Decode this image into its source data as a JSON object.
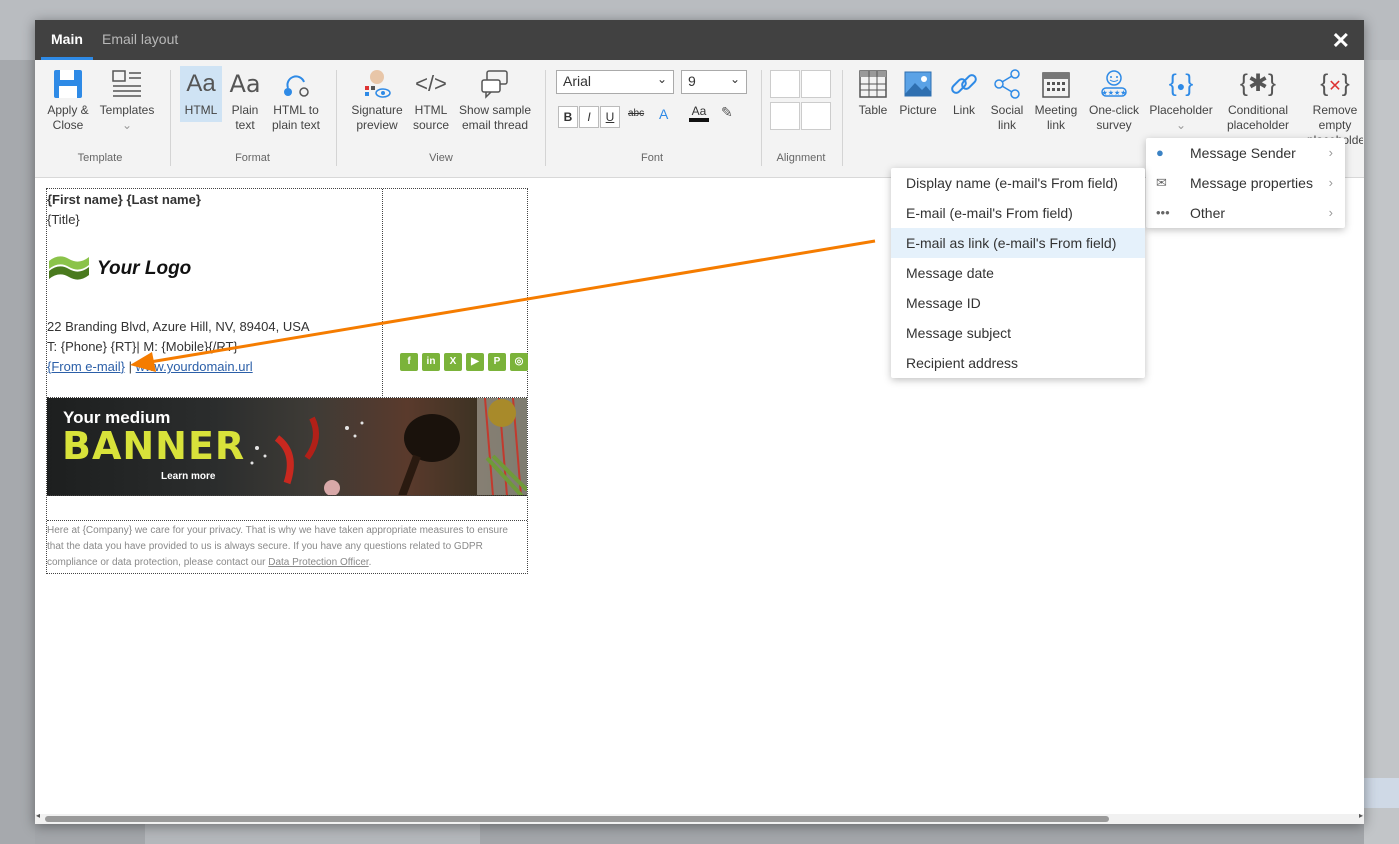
{
  "tabs": {
    "main": "Main",
    "email_layout": "Email layout"
  },
  "close_symbol": "✕",
  "ribbon": {
    "template": {
      "apply_close": "Apply & Close",
      "templates": "Templates",
      "label": "Template"
    },
    "format": {
      "html": "HTML",
      "plain_text": "Plain text",
      "html_to_plain": "HTML to plain text",
      "label": "Format"
    },
    "view": {
      "signature_preview": "Signature preview",
      "html_source": "HTML source",
      "show_sample": "Show sample email thread",
      "label": "View"
    },
    "font": {
      "family": "Arial",
      "size": "9",
      "bold": "B",
      "italic": "I",
      "underline": "U",
      "strike": "abc",
      "label": "Font"
    },
    "alignment": {
      "label": "Alignment"
    },
    "insert": {
      "table": "Table",
      "picture": "Picture",
      "link": "Link",
      "social_link": "Social link",
      "meeting_link": "Meeting link",
      "one_click_survey": "One-click survey",
      "placeholder": "Placeholder",
      "conditional_placeholder": "Conditional placeholder",
      "remove_empty": "Remove empty placeholders"
    }
  },
  "signature": {
    "name_line": "{First name} {Last name}",
    "title": "{Title}",
    "logo_text": "Your Logo",
    "address": "22 Branding Blvd, Azure Hill, NV, 89404, USA",
    "phone_line": "T: {Phone} {RT}| M: {Mobile}{/RT}",
    "email_link": "{From e-mail}",
    "separator": " | ",
    "website": "www.yourdomain.url",
    "social": [
      "f",
      "in",
      "X",
      "▶",
      "P",
      "◎"
    ],
    "banner": {
      "line1": "Your medium",
      "line2": "BANNER",
      "cta": "Learn more"
    },
    "gdpr_text": "Here at {Company} we care for your privacy. That is why we have taken appropriate measures to ensure that the data you have provided to us is always secure. If you have any questions related to GDPR compliance or data protection, please contact our ",
    "gdpr_link": "Data Protection Officer",
    "gdpr_end": "."
  },
  "placeholder_menu": {
    "items": [
      {
        "label": "Message Sender",
        "icon": "person-icon"
      },
      {
        "label": "Message properties",
        "icon": "envelope-icon"
      },
      {
        "label": "Other",
        "icon": "more-icon"
      }
    ]
  },
  "sender_submenu": {
    "items": [
      "Display name (e-mail's From field)",
      "E-mail (e-mail's From field)",
      "E-mail as link (e-mail's From field)",
      "Message date",
      "Message ID",
      "Message subject",
      "Recipient address"
    ],
    "highlighted_index": 2
  },
  "colors": {
    "accent": "#2e8ae6",
    "arrow": "#f57c00",
    "social": "#7bb33a",
    "banner_text": "#d8e23a"
  }
}
